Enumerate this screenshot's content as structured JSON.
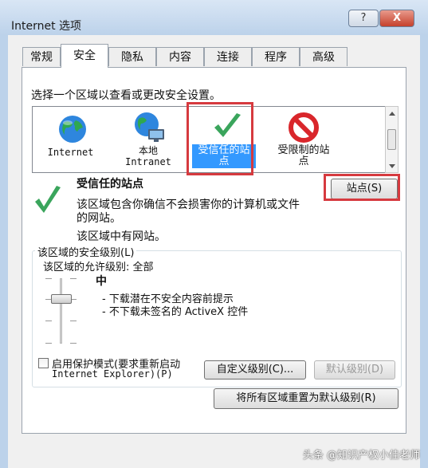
{
  "window": {
    "title": "Internet 选项",
    "help_label": "?",
    "close_label": "X"
  },
  "tabs": [
    {
      "label": "常规"
    },
    {
      "label": "安全"
    },
    {
      "label": "隐私"
    },
    {
      "label": "内容"
    },
    {
      "label": "连接"
    },
    {
      "label": "程序"
    },
    {
      "label": "高级"
    }
  ],
  "security": {
    "instruction": "选择一个区域以查看或更改安全设置。",
    "zones": [
      {
        "line1": "Internet",
        "line2": "",
        "icon": "globe-icon"
      },
      {
        "line1": "本地",
        "line2": "Intranet",
        "icon": "intranet-globe-icon"
      },
      {
        "line1": "受信任的站",
        "line2": "点",
        "icon": "checkmark-icon",
        "selected": true
      },
      {
        "line1": "受限制的站",
        "line2": "点",
        "icon": "no-entry-icon"
      }
    ],
    "selected_zone": {
      "title": "受信任的站点",
      "desc_line1": "该区域包含你确信不会损害你的计算机或文件",
      "desc_line2": "的网站。",
      "has_sites": "该区域中有网站。"
    },
    "sites_button": "站点(S)",
    "level_group": {
      "label": "该区域的安全级别(L)",
      "allowed_levels": "该区域的允许级别: 全部",
      "level_name": "中",
      "bullet1": "- 下载潜在不安全内容前提示",
      "bullet2": "- 不下载未签名的 ActiveX 控件",
      "slider_level": "中"
    },
    "protected_mode": {
      "label_line1": "启用保护模式(要求重新启动",
      "label_line2": "Internet Explorer)(P)",
      "checked": false
    },
    "custom_level_button": "自定义级别(C)...",
    "default_level_button": "默认级别(D)",
    "reset_all_button": "将所有区域重置为默认级别(R)"
  },
  "watermark": "头条 @知识产权小佳老师",
  "colors": {
    "highlight": "#3399ff",
    "annotation_red": "#d63a3f"
  }
}
